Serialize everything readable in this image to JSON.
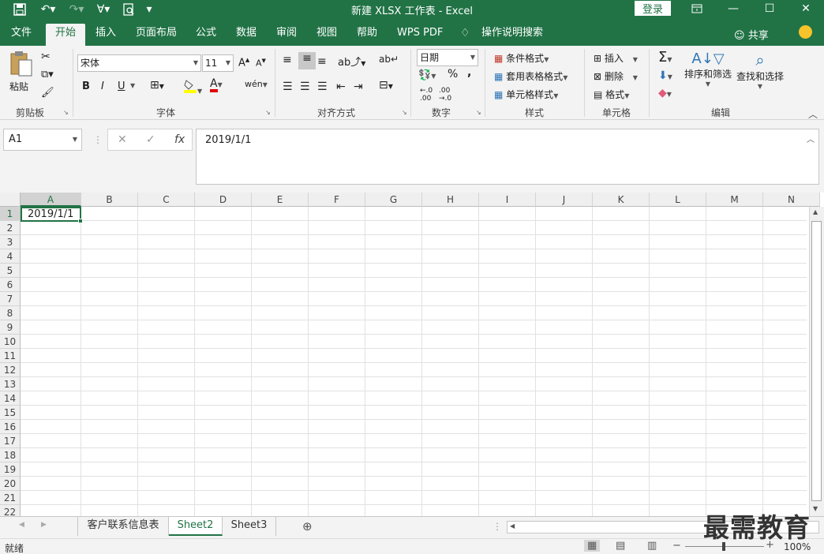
{
  "title_bar": {
    "title": "新建 XLSX 工作表  -  Excel",
    "login_label": "登录"
  },
  "tabs": [
    {
      "label": "文件",
      "active": false
    },
    {
      "label": "开始",
      "active": true
    },
    {
      "label": "插入",
      "active": false
    },
    {
      "label": "页面布局",
      "active": false
    },
    {
      "label": "公式",
      "active": false
    },
    {
      "label": "数据",
      "active": false
    },
    {
      "label": "审阅",
      "active": false
    },
    {
      "label": "视图",
      "active": false
    },
    {
      "label": "帮助",
      "active": false
    },
    {
      "label": "WPS PDF",
      "active": false
    }
  ],
  "tell_me": "操作说明搜索",
  "share_label": "共享",
  "ribbon": {
    "clipboard": {
      "paste_label": "粘贴",
      "group_label": "剪贴板"
    },
    "font": {
      "font_name": "宋体",
      "font_size": "11",
      "group_label": "字体",
      "bold": "B",
      "italic": "I",
      "underline": "U"
    },
    "alignment": {
      "group_label": "对齐方式"
    },
    "number": {
      "format": "日期",
      "percent": "%",
      "comma": ",",
      "group_label": "数字"
    },
    "styles": {
      "conditional": "条件格式",
      "table_style": "套用表格格式",
      "cell_style": "单元格样式",
      "group_label": "样式"
    },
    "cells": {
      "insert": "插入",
      "delete": "删除",
      "format": "格式",
      "group_label": "单元格"
    },
    "editing": {
      "sort_filter": "排序和筛选",
      "find_select": "查找和选择",
      "group_label": "编辑"
    }
  },
  "formula_bar": {
    "name_box": "A1",
    "cancel": "✕",
    "enter": "✓",
    "fx": "fx",
    "value": "2019/1/1"
  },
  "grid": {
    "columns": [
      "A",
      "B",
      "C",
      "D",
      "E",
      "F",
      "G",
      "H",
      "I",
      "J",
      "K",
      "L",
      "M",
      "N"
    ],
    "rows": [
      "1",
      "2",
      "3",
      "4",
      "5",
      "6",
      "7",
      "8",
      "9",
      "10",
      "11",
      "12",
      "13",
      "14",
      "15",
      "16",
      "17",
      "18",
      "19",
      "20",
      "21",
      "22"
    ],
    "selected_cell": "A1",
    "cell_a1": "2019/1/1"
  },
  "sheets": [
    {
      "label": "客户联系信息表",
      "active": false
    },
    {
      "label": "Sheet2",
      "active": true
    },
    {
      "label": "Sheet3",
      "active": false
    }
  ],
  "status": {
    "ready": "就绪",
    "zoom": "100%"
  },
  "watermark": "最需教育",
  "colors": {
    "accent": "#217346",
    "smiley": "#f6c32b"
  }
}
